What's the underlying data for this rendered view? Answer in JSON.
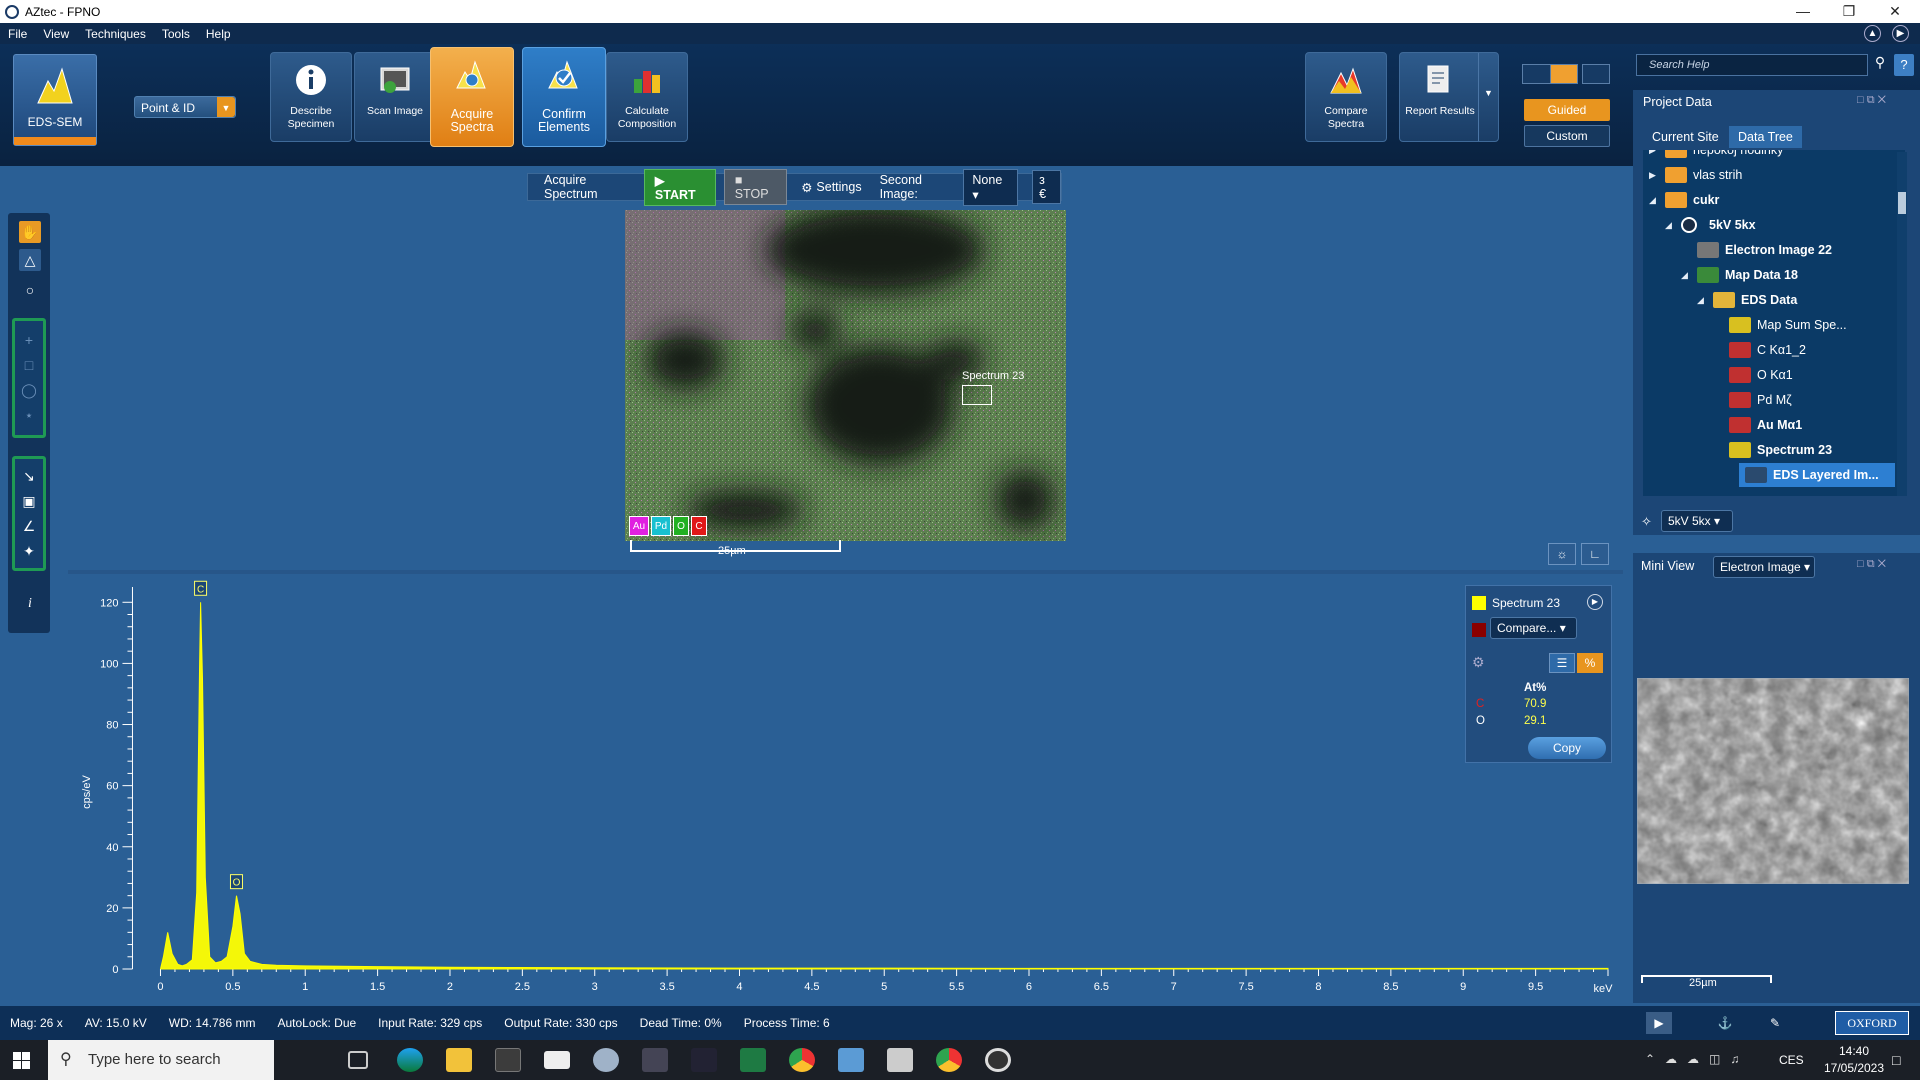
{
  "app": {
    "title": "AZtec - FPNO"
  },
  "menu": [
    "File",
    "View",
    "Techniques",
    "Tools",
    "Help"
  ],
  "ribbon": {
    "mode": "EDS-SEM",
    "point_id": "Point & ID",
    "steps": [
      {
        "label": "Describe Specimen"
      },
      {
        "label": "Scan Image"
      },
      {
        "label": "Acquire Spectra"
      },
      {
        "label": "Confirm Elements"
      },
      {
        "label": "Calculate Composition"
      }
    ],
    "compare": "Compare Spectra",
    "report": "Report Results",
    "guided": "Guided",
    "custom": "Custom",
    "search_placeholder": "Search Help"
  },
  "acquire": {
    "label": "Acquire Spectrum",
    "start": "START",
    "stop": "STOP",
    "settings": "Settings",
    "second_image_label": "Second Image:",
    "second_image_value": "None",
    "extra": "з €"
  },
  "map": {
    "spectrum_label": "Spectrum 23",
    "elements": [
      {
        "sym": "Au",
        "color": "#e020e0"
      },
      {
        "sym": "Pd",
        "color": "#18c0d0"
      },
      {
        "sym": "O",
        "color": "#22b022"
      },
      {
        "sym": "C",
        "color": "#e01818"
      }
    ],
    "scale": "25µm"
  },
  "spectrum": {
    "legend_series": "Spectrum 23",
    "compare": "Compare...",
    "at_header": "At%",
    "rows": [
      {
        "el": "C",
        "val": "70.9"
      },
      {
        "el": "O",
        "val": "29.1"
      }
    ],
    "copy": "Copy"
  },
  "chart_data": {
    "type": "line",
    "ylabel": "cps/eV",
    "xunit": "keV",
    "xlim": [
      -0.1,
      10.0
    ],
    "ylim": [
      0,
      125
    ],
    "xticks": [
      "0",
      "0.5",
      "1",
      "1.5",
      "2",
      "2.5",
      "3",
      "3.5",
      "4",
      "4.5",
      "5",
      "5.5",
      "6",
      "6.5",
      "7",
      "7.5",
      "8",
      "8.5",
      "9",
      "9.5"
    ],
    "yticks": [
      0,
      20,
      40,
      60,
      80,
      100,
      120
    ],
    "series": [
      {
        "color": "#ffff00",
        "x": [
          0,
          0.02,
          0.05,
          0.08,
          0.12,
          0.15,
          0.18,
          0.22,
          0.25,
          0.27,
          0.277,
          0.29,
          0.31,
          0.34,
          0.38,
          0.42,
          0.46,
          0.5,
          0.525,
          0.55,
          0.58,
          0.62,
          0.7,
          0.8,
          1.0,
          1.5,
          2.0,
          2.5,
          3.0,
          4.0,
          5.0,
          6.0,
          7.0,
          8.0,
          9.0,
          10.0
        ],
        "y": [
          0,
          4,
          12,
          5,
          1.5,
          1,
          1.5,
          3,
          25,
          100,
          120,
          95,
          30,
          4,
          2,
          2.5,
          4,
          14,
          24,
          18,
          5,
          2.5,
          1.5,
          1.2,
          1,
          0.8,
          0.6,
          0.5,
          0.4,
          0.3,
          0.3,
          0.2,
          0.2,
          0.2,
          0.2,
          0.2
        ]
      }
    ],
    "peak_labels": [
      {
        "label": "C",
        "x": 0.277,
        "y": 120
      },
      {
        "label": "O",
        "x": 0.525,
        "y": 24
      }
    ]
  },
  "project": {
    "title": "Project Data",
    "tabs": [
      "Current Site",
      "Data Tree"
    ],
    "tree": [
      {
        "label": "nepokoj hodinky",
        "level": 0,
        "arrow": "▶",
        "icon": "site",
        "bold": false
      },
      {
        "label": "vlas strih",
        "level": 0,
        "arrow": "▶",
        "icon": "site",
        "bold": false
      },
      {
        "label": "cukr",
        "level": 0,
        "arrow": "◢",
        "icon": "site",
        "bold": true
      },
      {
        "label": "5kV 5kx",
        "level": 1,
        "arrow": "◢",
        "icon": "target",
        "bold": true
      },
      {
        "label": "Electron Image 22",
        "level": 2,
        "arrow": "",
        "icon": "image",
        "bold": true
      },
      {
        "label": "Map Data 18",
        "level": 2,
        "arrow": "◢",
        "icon": "map",
        "bold": true
      },
      {
        "label": "EDS Data",
        "level": 3,
        "arrow": "◢",
        "icon": "folder",
        "bold": true
      },
      {
        "label": "Map Sum Spe...",
        "level": 4,
        "arrow": "",
        "icon": "spectrum",
        "bold": false
      },
      {
        "label": "C Kα1_2",
        "level": 4,
        "arrow": "",
        "icon": "mapred",
        "bold": false
      },
      {
        "label": "O Kα1",
        "level": 4,
        "arrow": "",
        "icon": "mapred",
        "bold": false
      },
      {
        "label": "Pd Mζ",
        "level": 4,
        "arrow": "",
        "icon": "mapred",
        "bold": false
      },
      {
        "label": "Au Mα1",
        "level": 4,
        "arrow": "",
        "icon": "mapred",
        "bold": true
      },
      {
        "label": "Spectrum 23",
        "level": 4,
        "arrow": "",
        "icon": "spectrum",
        "bold": true
      },
      {
        "label": "EDS Layered Im...",
        "level": 3,
        "arrow": "",
        "icon": "layers",
        "bold": true,
        "selected": true
      }
    ],
    "site_select": "5kV 5kx"
  },
  "miniview": {
    "title": "Mini View",
    "select": "Electron Image",
    "scale": "25µm"
  },
  "status": {
    "mag": "Mag: 26 x",
    "av": "AV: 15.0 kV",
    "wd": "WD: 14.786 mm",
    "autolock": "AutoLock: Due",
    "input": "Input Rate: 329 cps",
    "output": "Output Rate: 330 cps",
    "dead": "Dead Time: 0%",
    "process": "Process Time: 6",
    "brand": "OXFORD"
  },
  "taskbar": {
    "search_placeholder": "Type here to search",
    "lang": "CES",
    "time": "14:40",
    "date": "17/05/2023"
  },
  "colors": {
    "accent": "#e8951f",
    "bg": "#2a5f95",
    "spectrum": "#ffff00"
  }
}
